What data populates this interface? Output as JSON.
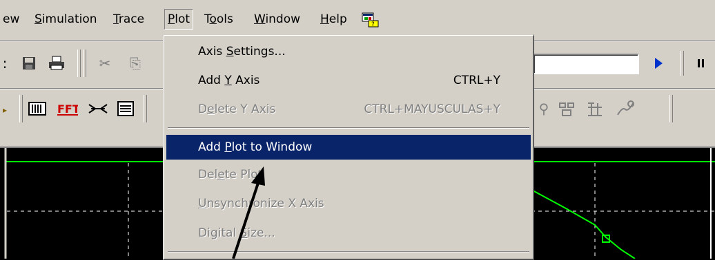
{
  "menubar": {
    "items": [
      {
        "label": "ew",
        "mnemonic_index": -1
      },
      {
        "label": "Simulation",
        "mnemonic_index": 0
      },
      {
        "label": "Trace",
        "mnemonic_index": 0
      },
      {
        "label": "Plot",
        "mnemonic_index": 0
      },
      {
        "label": "Tools",
        "mnemonic_index": 1
      },
      {
        "label": "Window",
        "mnemonic_index": 0
      },
      {
        "label": "Help",
        "mnemonic_index": 0
      }
    ],
    "open_menu": "Plot"
  },
  "plot_menu": {
    "items": [
      {
        "label": "Axis Settings...",
        "shortcut": "",
        "enabled": true,
        "highlighted": false
      },
      {
        "label": "Add Y Axis",
        "shortcut": "CTRL+Y",
        "enabled": true,
        "highlighted": false
      },
      {
        "label": "Delete Y Axis",
        "shortcut": "CTRL+MAYUSCULAS+Y",
        "enabled": false,
        "highlighted": false
      },
      {
        "label": "Add Plot to Window",
        "shortcut": "",
        "enabled": true,
        "highlighted": true
      },
      {
        "label": "Delete Plot",
        "shortcut": "",
        "enabled": false,
        "highlighted": false
      },
      {
        "label": "Unsynchronize X Axis",
        "shortcut": "",
        "enabled": false,
        "highlighted": false
      },
      {
        "label": "Digital Size...",
        "shortcut": "",
        "enabled": false,
        "highlighted": false
      }
    ]
  },
  "colors": {
    "menu_highlight": "#0a246a",
    "plot_background": "#000000",
    "trace": "#00ff00",
    "grid": "#ffffff",
    "run_arrow": "#0033cc"
  },
  "icons": [
    "save-icon",
    "print-icon",
    "cut-icon",
    "copy-icon",
    "run-icon",
    "pause-icon",
    "bars-icon",
    "fft-icon",
    "markers-icon",
    "list-icon",
    "binoculars-icon",
    "plot-tools-icon",
    "window-icon"
  ]
}
